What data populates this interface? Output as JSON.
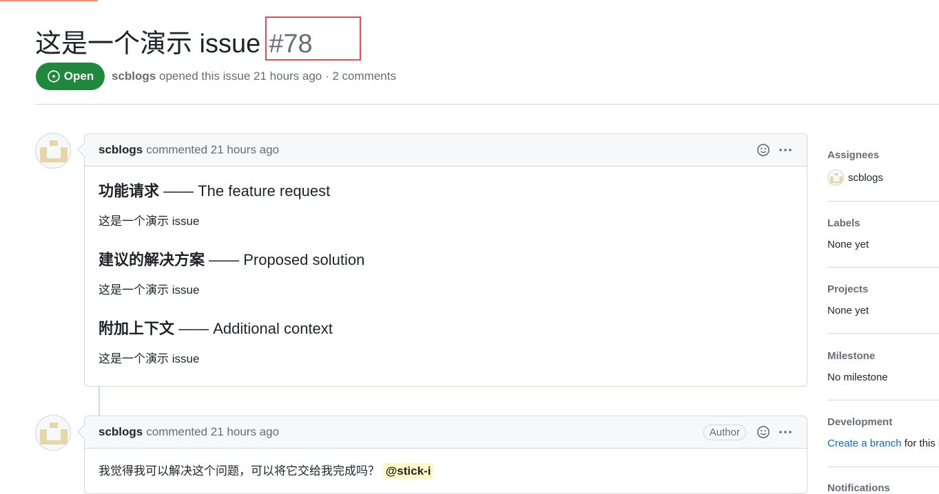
{
  "issue": {
    "title": "这是一个演示 issue",
    "number": "#78",
    "state": "Open",
    "author": "scblogs",
    "opened_text": "opened this issue 21 hours ago · 2 comments"
  },
  "comments": [
    {
      "author": "scblogs",
      "action": "commented 21 hours ago",
      "sections": [
        {
          "heading_cn": "功能请求",
          "heading_en": " —— The feature request",
          "body": "这是一个演示 issue"
        },
        {
          "heading_cn": "建议的解决方案",
          "heading_en": " —— Proposed solution",
          "body": "这是一个演示 issue"
        },
        {
          "heading_cn": "附加上下文",
          "heading_en": " —— Additional context",
          "body": "这是一个演示 issue"
        }
      ]
    },
    {
      "author": "scblogs",
      "action": "commented 21 hours ago",
      "badge": "Author",
      "body": "我觉得我可以解决这个问题，可以将它交给我完成吗？",
      "mention": "@stick-i"
    }
  ],
  "sidebar": {
    "assignees": {
      "heading": "Assignees",
      "value": "scblogs"
    },
    "labels": {
      "heading": "Labels",
      "value": "None yet"
    },
    "projects": {
      "heading": "Projects",
      "value": "None yet"
    },
    "milestone": {
      "heading": "Milestone",
      "value": "No milestone"
    },
    "development": {
      "heading": "Development",
      "link": "Create a branch",
      "rest": " for this i"
    },
    "notifications": {
      "heading": "Notifications"
    }
  },
  "colors": {
    "open_green": "#1f883d",
    "highlight_red": "#e5484d",
    "link_blue": "#0969da",
    "mention_bg": "#fff8c5",
    "identicon": "#e6d7a8"
  },
  "icons": {
    "state": "issue-opened-icon",
    "reaction": "smiley-icon",
    "menu": "kebab-horizontal-icon"
  }
}
